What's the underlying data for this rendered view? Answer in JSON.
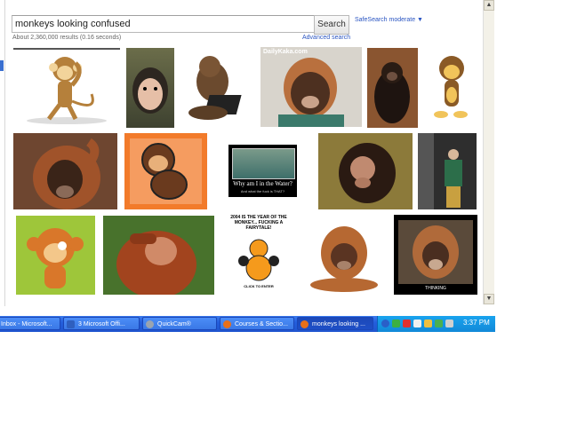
{
  "search": {
    "value": "monkeys looking confused",
    "button": "Search"
  },
  "safesearch": "SafeSearch moderate ▼",
  "result_stats": "About 2,360,000 results (0.16 seconds)",
  "advanced_search": "Advanced search",
  "images": [
    {
      "id": "cartoon-monkey-scratching"
    },
    {
      "id": "capuchin-face"
    },
    {
      "id": "thinking-ape-laptop"
    },
    {
      "id": "orangutan-dailykaka",
      "watermark": "DailyKaka.com"
    },
    {
      "id": "chimp-sitting-hand-on-head"
    },
    {
      "id": "cartoon-monkey-yellow"
    },
    {
      "id": "orangutan-scratching-head"
    },
    {
      "id": "cartoon-brown-monkey-orange-bg"
    },
    {
      "id": "why-am-i-in-the-water",
      "caption": "Why am I in the Water?",
      "subcaption": "And what the fuck is THAT?"
    },
    {
      "id": "chimp-confused-grass"
    },
    {
      "id": "man-in-office"
    },
    {
      "id": "cartoon-monkey-green-bg"
    },
    {
      "id": "orangutan-covering-face"
    },
    {
      "id": "year-of-the-monkey",
      "text": "2004 IS THE YEAR OF THE MONKEY... FUCKING A FAIRYTALE!",
      "subtext": "CLICK TO ENTER"
    },
    {
      "id": "baby-orangutan"
    },
    {
      "id": "orangutan-motivational",
      "caption": "THINKING"
    }
  ],
  "taskbar": {
    "items": [
      {
        "label": "Inbox - Microsoft...",
        "icon_color": "#f0c040"
      },
      {
        "label": "3 Microsoft Offi...",
        "icon_color": "#2f5fbf"
      },
      {
        "label": "QuickCam®",
        "icon_color": "#6a6a6a"
      },
      {
        "label": "Courses & Sectio...",
        "icon_color": "#e8701a"
      },
      {
        "label": "monkeys looking ...",
        "icon_color": "#e8701a"
      }
    ],
    "clock": "3:37 PM"
  },
  "colors": {
    "link": "#2a55c2",
    "taskbar": "#245edc",
    "tray": "#1289d8"
  }
}
